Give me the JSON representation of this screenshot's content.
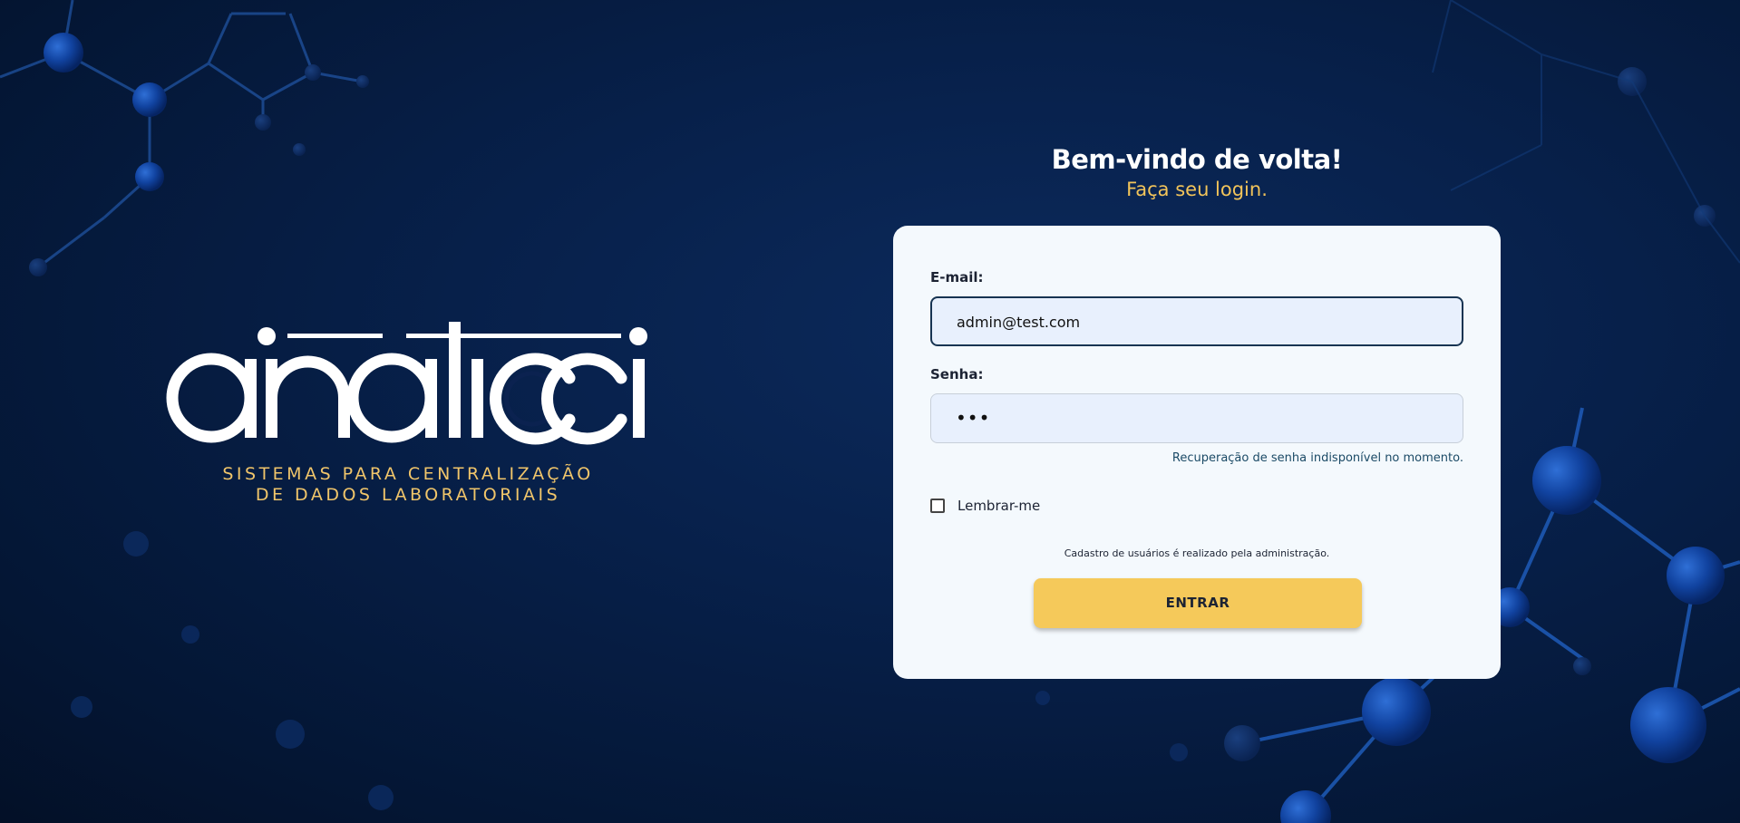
{
  "brand": {
    "logo_text": "analicci",
    "tagline_line1": "SISTEMAS PARA CENTRALIZAÇÃO",
    "tagline_line2": "DE DADOS LABORATORIAIS"
  },
  "welcome": {
    "title": "Bem-vindo de volta!",
    "subtitle": "Faça seu login."
  },
  "form": {
    "email_label": "E-mail:",
    "email_value": "admin@test.com",
    "password_label": "Senha:",
    "password_value": "•••",
    "recovery_note": "Recuperação de senha indisponível no momento.",
    "remember_label": "Lembrar-me",
    "remember_checked": false,
    "register_note": "Cadastro de usuários é realizado pela administração.",
    "submit_label": "ENTRAR"
  },
  "colors": {
    "background": "#06193d",
    "accent_yellow": "#f5c95a",
    "card_background": "#f4f9fd",
    "input_background": "#e8f0fd",
    "input_focus_border": "#173452"
  }
}
